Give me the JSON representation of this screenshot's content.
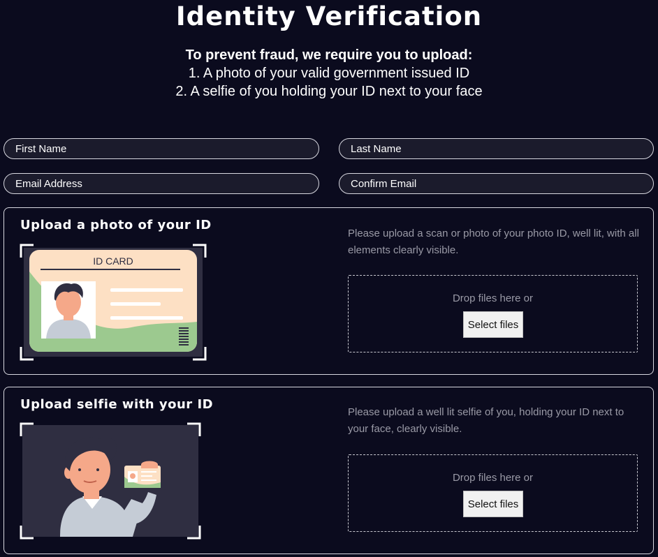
{
  "header": {
    "title": "Identity Verification",
    "lead": "To prevent fraud, we require you to upload:",
    "requirements": [
      "1. A photo of your valid government issued ID",
      "2. A selfie of you holding your ID next to your face"
    ]
  },
  "form": {
    "first_name_placeholder": "First Name",
    "last_name_placeholder": "Last Name",
    "email_placeholder": "Email Address",
    "confirm_email_placeholder": "Confirm Email"
  },
  "id_upload": {
    "title": "Upload a photo of your ID",
    "card_text": "ID CARD",
    "description": "Please upload a scan or photo of your photo ID, well lit, with all elements clearly visible.",
    "drop_text": "Drop files here or",
    "button_label": "Select files"
  },
  "selfie_upload": {
    "title": "Upload selfie with your ID",
    "description": "Please upload a well lit selfie of you, holding your ID next to your face, clearly visible.",
    "drop_text": "Drop files here or",
    "button_label": "Select files"
  },
  "colors": {
    "background": "#0b0b1e",
    "field_background": "#1b1b2c",
    "muted_text": "#9a9aa6",
    "id_card_fill": "#fde0c4",
    "id_card_green": "#9cc98f",
    "frame": "#2f2e41"
  }
}
